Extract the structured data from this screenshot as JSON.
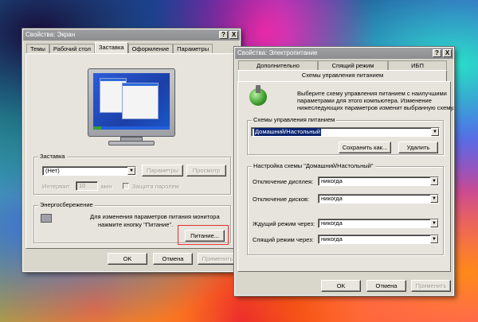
{
  "display_dialog": {
    "title": "Свойства: Экран",
    "tabs": [
      "Темы",
      "Рабочий стол",
      "Заставка",
      "Оформление",
      "Параметры"
    ],
    "active_tab": "Заставка",
    "screensaver_group_title": "Заставка",
    "screensaver_value": "(Нет)",
    "settings_button": "Параметры",
    "preview_button": "Просмотр",
    "interval_label": "Интервал:",
    "interval_value": "10",
    "interval_unit": "мин",
    "password_label": "Защита паролем",
    "energy_group_title": "Энергосбережение",
    "energy_text_1": "Для изменения параметров питания монитора",
    "energy_text_2": "нажмите кнопку \"Питание\".",
    "power_button": "Питание...",
    "ok_button": "OK",
    "cancel_button": "Отмена",
    "apply_button": "Применить"
  },
  "power_dialog": {
    "title": "Свойства: Электропитание",
    "tabs_back": [
      "Дополнительно",
      "Спящий режим",
      "ИБП"
    ],
    "active_tab": "Схемы управления питанием",
    "description_1": "Выберите схему управления питанием с наилучшими",
    "description_2": "параметрами для этого компьютера. Изменение",
    "description_3": "нижеследующих параметров изменит выбранную схему.",
    "schemes_group_title": "Схемы управления питанием",
    "scheme_value": "Домашний/Настольный",
    "save_as_button": "Сохранить как...",
    "delete_button": "Удалить",
    "settings_group_title": "Настройка схемы \"Домашний/Настольный\"",
    "rows": [
      {
        "label": "Отключение дисплея:",
        "value": "никогда"
      },
      {
        "label": "Отключение дисков:",
        "value": "никогда"
      },
      {
        "label": "Ждущий режим через:",
        "value": "никогда"
      },
      {
        "label": "Спящий режим через:",
        "value": "никогда"
      }
    ],
    "ok_button": "OK",
    "cancel_button": "Отмена",
    "apply_button": "Применить"
  },
  "icons": {
    "help": "?",
    "close": "X",
    "dropdown": "▼"
  },
  "colors": {
    "titlebar": "#9fa0a2",
    "window_bg": "#d9d6cc",
    "selection": "#0a2470",
    "highlight_border": "#e03030"
  }
}
